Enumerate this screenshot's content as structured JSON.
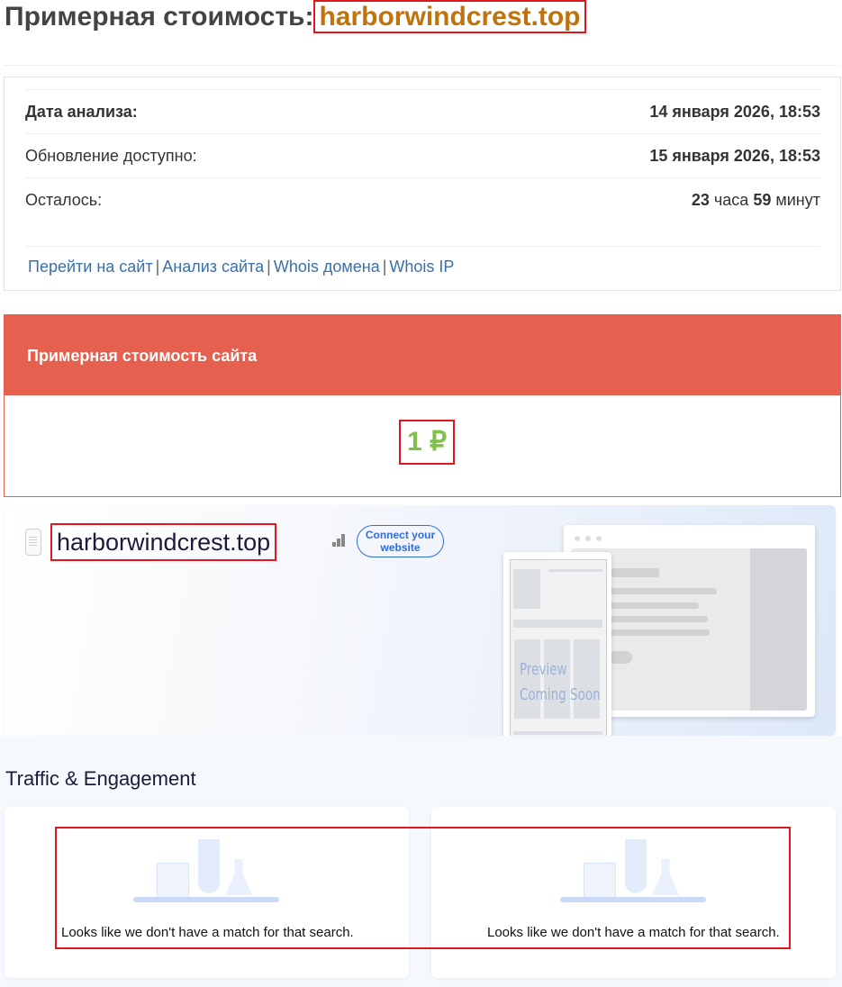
{
  "header": {
    "prefix": "Примерная стоимость:",
    "domain": "harborwindcrest.top"
  },
  "info": {
    "analysis_label": "Дата анализа:",
    "analysis_value": "14 января 2026, 18:53",
    "update_label": "Обновление доступно:",
    "update_value": "15 января 2026, 18:53",
    "remaining_label": "Осталось:",
    "remaining_hours": "23",
    "remaining_hours_unit": "часа",
    "remaining_minutes": "59",
    "remaining_minutes_unit": "минут"
  },
  "links": [
    "Перейти на сайт",
    "Анализ сайта",
    "Whois домена",
    "Whois IP"
  ],
  "price": {
    "heading": "Примерная стоимость сайта",
    "value": "1 ₽"
  },
  "preview": {
    "domain": "harborwindcrest.top",
    "connect_label": "Connect your website",
    "placeholder_line1": "Preview",
    "placeholder_line2": "Coming Soon"
  },
  "traffic": {
    "title": "Traffic & Engagement",
    "cards": [
      {
        "message": "Looks like we don't have a match for that search."
      },
      {
        "message": "Looks like we don't have a match for that search."
      }
    ]
  },
  "colors": {
    "accent_red": "#e5604f",
    "price_green": "#7fc14b",
    "domain_orange": "#c0720c",
    "link_blue": "#3a6fa8",
    "connect_blue": "#2f6de0"
  }
}
